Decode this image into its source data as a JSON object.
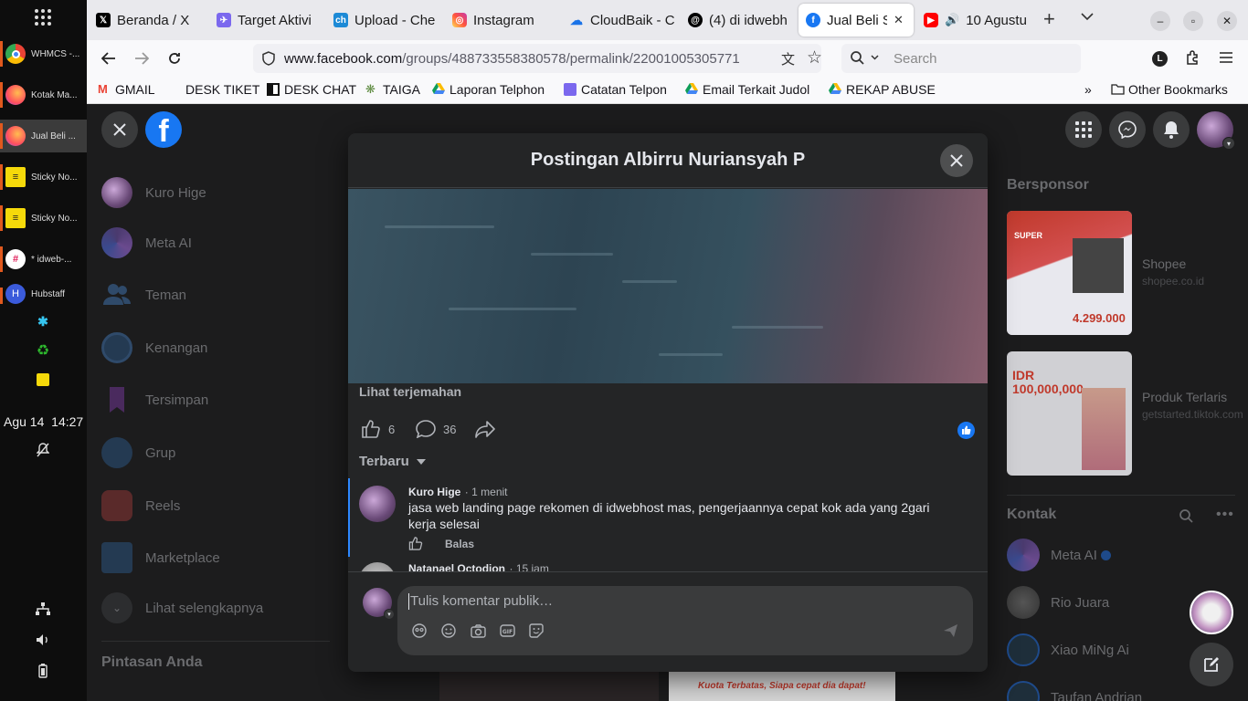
{
  "dock": {
    "apps": [
      {
        "label": "WHMCS -...",
        "color": "#1e8e3e"
      },
      {
        "label": "Kotak Ma...",
        "color": "#ff7139"
      },
      {
        "label": "Jual Beli ...",
        "color": "#ff7139"
      },
      {
        "label": "Sticky No...",
        "color": "#f5d90a"
      },
      {
        "label": "Sticky No...",
        "color": "#f5d90a"
      },
      {
        "label": "* idweb-...",
        "color": "#4a154b"
      },
      {
        "label": "Hubstaff",
        "color": "#3b5bdb"
      }
    ],
    "clock_date": "Agu 14",
    "clock_time": "14:27"
  },
  "browser": {
    "tabs": [
      {
        "label": "Beranda / X",
        "icon": "x-icon"
      },
      {
        "label": "Target Aktivi",
        "icon": "plane-icon"
      },
      {
        "label": "Upload - Che",
        "icon": "ch-icon"
      },
      {
        "label": "Instagram",
        "icon": "instagram-icon"
      },
      {
        "label": "CloudBaik - C",
        "icon": "cloud-icon"
      },
      {
        "label": "(4) di idwebh",
        "icon": "threads-icon"
      },
      {
        "label": "Jual Beli So",
        "icon": "facebook-icon"
      },
      {
        "label": "10 Agustu",
        "icon": "youtube-icon"
      }
    ],
    "url_host": "www.facebook.com",
    "url_path": "/groups/488733558380578/permalink/22001005305771",
    "search_placeholder": "Search",
    "profile_letter": "L",
    "bookmarks": [
      "GMAIL",
      "DESK TIKET",
      "DESK CHAT",
      "TAIGA",
      "Laporan Telphon",
      "Catatan Telpon",
      "Email Terkait Judol",
      "REKAP ABUSE"
    ],
    "other_bookmarks": "Other Bookmarks"
  },
  "sidebar": {
    "items": [
      "Kuro Hige",
      "Meta AI",
      "Teman",
      "Kenangan",
      "Tersimpan",
      "Grup",
      "Reels",
      "Marketplace",
      "Lihat selengkapnya"
    ],
    "shortcuts_title": "Pintasan Anda"
  },
  "modal": {
    "title": "Postingan Albirru Nuriansyah P",
    "see_translation": "Lihat terjemahan",
    "likes": "6",
    "comments": "36",
    "sort_label": "Terbaru",
    "comments_list": [
      {
        "name": "Kuro Hige",
        "time": "1 menit",
        "text": "jasa web landing page rekomen di idwebhost mas, pengerjaannya cepat kok ada yang 2gari kerja selesai",
        "reply": "Balas"
      },
      {
        "name": "Natanael Octodion",
        "time": "15 jam"
      }
    ],
    "composer_placeholder": "Tulis komentar publik…"
  },
  "right": {
    "sponsored_title": "Bersponsor",
    "ads": [
      {
        "name": "Shopee",
        "domain": "shopee.co.id",
        "banner_line1": "SUPER",
        "banner_price": "4.299.000"
      },
      {
        "name": "Produk Terlaris",
        "domain": "getstarted.tiktok.com",
        "banner_line1": "IDR",
        "banner_price": "100,000,000"
      }
    ],
    "contacts_title": "Kontak",
    "contacts": [
      "Meta AI",
      "Rio Juara",
      "Xiao MiNg Ai",
      "Taufan Andrian"
    ]
  },
  "feed_peek": "Kuota Terbatas, Siapa cepat dia dapat!"
}
